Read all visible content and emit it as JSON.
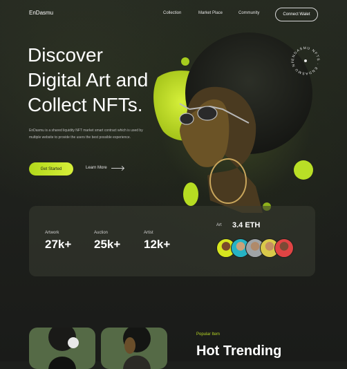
{
  "header": {
    "logo": "EnDasmu",
    "nav": [
      "Collection",
      "Market Place",
      "Community"
    ],
    "connect_label": "Connect Walet"
  },
  "hero": {
    "title_lines": [
      "Discover",
      "Digital Art and",
      "Collect NFTs."
    ],
    "description": "EnDasmu is a shared liquidity NFT market smart contract which is used by multiple website to provide the users the best possible experience.",
    "get_started": "Get Started",
    "learn_more": "Learn More",
    "badge_text": "ENDASMU NFTS · ENDASMU NFTS ·"
  },
  "stats": {
    "items": [
      {
        "label": "Artwork",
        "value": "27k+"
      },
      {
        "label": "Auction",
        "value": "25k+"
      },
      {
        "label": "Artist",
        "value": "12k+"
      }
    ],
    "art_label": "Art",
    "art_value": "3.4 ETH"
  },
  "section": {
    "eyebrow": "Popular Item",
    "title": "Hot Trending"
  },
  "colors": {
    "accent": "#c6e52b",
    "background": "#1d1f1c"
  }
}
